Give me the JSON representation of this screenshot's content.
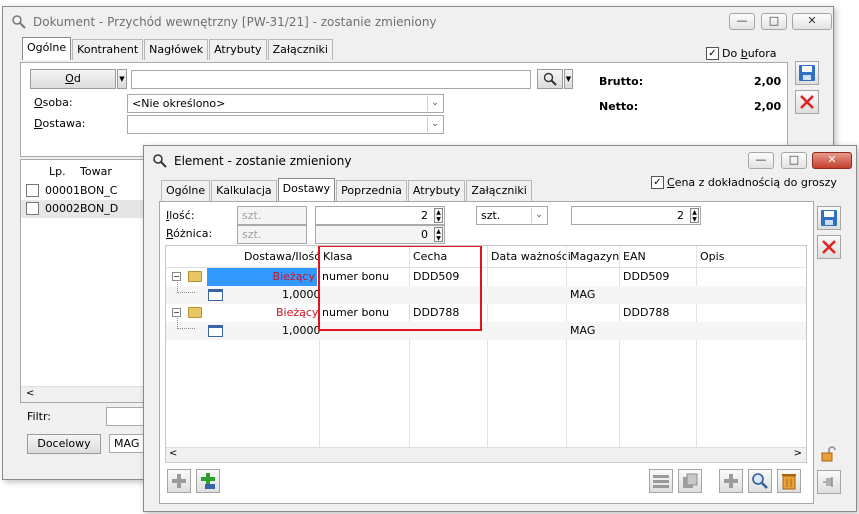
{
  "main": {
    "title": "Dokument - Przychód wewnętrzny [PW-31/21]  - zostanie zmieniony",
    "tabs": [
      "Ogólne",
      "Kontrahent",
      "Nagłówek",
      "Atrybuty",
      "Załączniki"
    ],
    "do_bufora": {
      "before": "Do ",
      "mnemonic": "b",
      "after": "ufora",
      "checked": true
    },
    "od_button": {
      "mnemonic": "O",
      "after": "d"
    },
    "od_value": "",
    "osoba_label": {
      "mnemonic": "O",
      "after": "soba:"
    },
    "osoba_value": "<Nie określono>",
    "dostawa_label": {
      "mnemonic": "D",
      "after": "ostawa:"
    },
    "dostawa_value": "",
    "brutto_label": "Brutto:",
    "brutto_value": "2,00",
    "netto_label": "Netto:",
    "netto_value": "2,00",
    "list_headers": {
      "lp": "Lp.",
      "towar": "Towar"
    },
    "rows": [
      {
        "lp": "00001",
        "towar": "BON_C"
      },
      {
        "lp": "00002",
        "towar": "BON_D"
      }
    ],
    "filtr_label": "Filtr:",
    "docelowy_button": "Docelowy",
    "magazyn_value": "MAG"
  },
  "element": {
    "title": "Element - zostanie zmieniony",
    "tabs": [
      "Ogólne",
      "Kalkulacja",
      "Dostawy",
      "Poprzednia",
      "Atrybuty",
      "Załączniki"
    ],
    "active_tab": "Dostawy",
    "cena_checkbox": {
      "mnemonic": "C",
      "after": "ena z dokładnością do groszy",
      "checked": true
    },
    "ilosc_label": {
      "mnemonic": "I",
      "after": "lość:"
    },
    "ilosc_unit": "szt.",
    "ilosc_value": "2",
    "unit_select": "szt.",
    "ilosc_value2": "2",
    "roznica_label": {
      "mnemonic": "R",
      "after": "óżnica:"
    },
    "roznica_unit": "szt.",
    "roznica_value": "0",
    "grid_headers": [
      "Dostawa/Ilość",
      "Klasa",
      "Cecha",
      "Data ważności",
      "Magazyn",
      "EAN",
      "Opis"
    ],
    "grid_rows": [
      {
        "dostawa": "Bieżący",
        "klasa": "numer bonu",
        "cecha": "DDD509",
        "data": "",
        "magazyn": "",
        "ean": "DDD509",
        "opis": "",
        "level": 0,
        "selected": true
      },
      {
        "dostawa": "1,0000",
        "klasa": "",
        "cecha": "",
        "data": "",
        "magazyn": "MAG",
        "ean": "",
        "opis": "",
        "level": 1,
        "selected": false
      },
      {
        "dostawa": "Bieżący",
        "klasa": "numer bonu",
        "cecha": "DDD788",
        "data": "",
        "magazyn": "",
        "ean": "DDD788",
        "opis": "",
        "level": 0,
        "selected": false
      },
      {
        "dostawa": "1,0000",
        "klasa": "",
        "cecha": "",
        "data": "",
        "magazyn": "MAG",
        "ean": "",
        "opis": "",
        "level": 1,
        "selected": false
      }
    ],
    "colors": {
      "accent": "#3399ff",
      "current_text": "#d01020",
      "highlight_box": "#e0141e",
      "close_btn": "#c4402c"
    }
  }
}
